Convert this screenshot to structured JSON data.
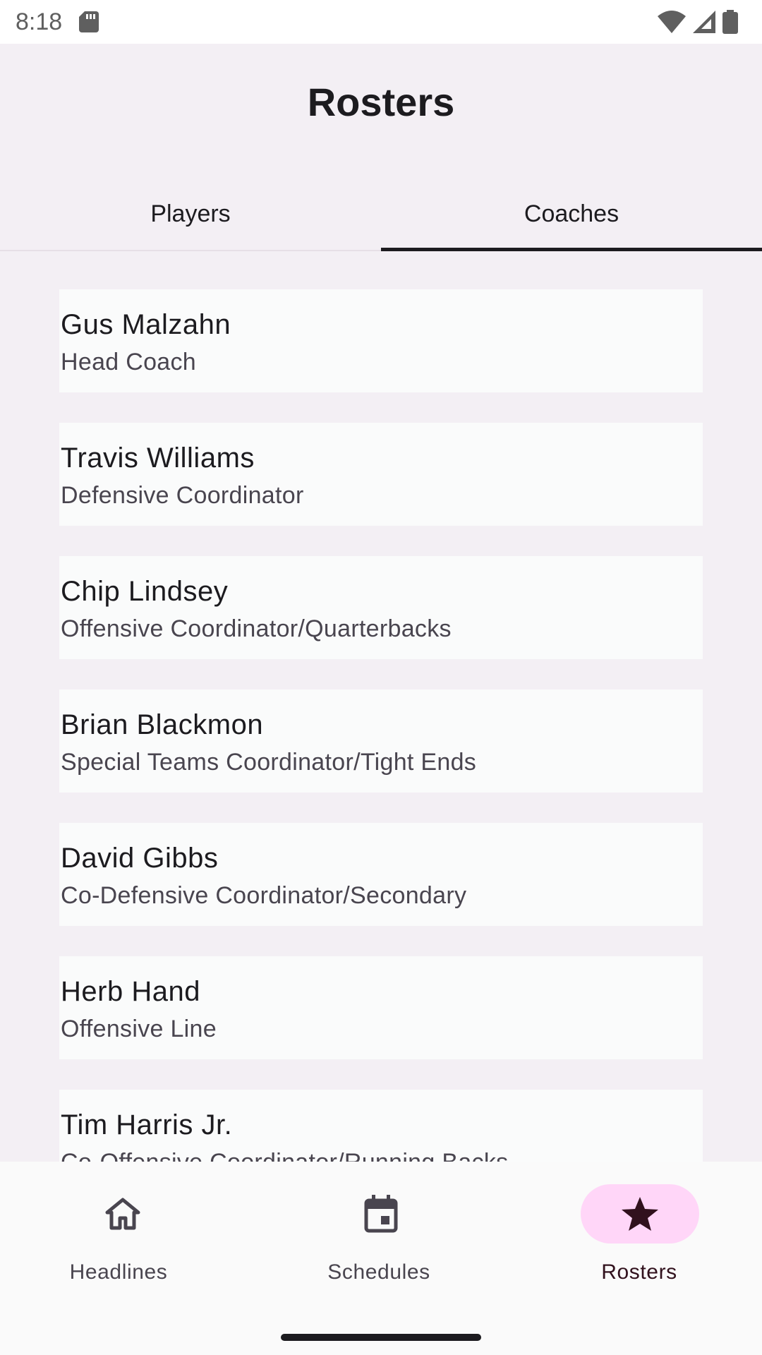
{
  "status_bar": {
    "time": "8:18",
    "icons": [
      "sd-card-icon",
      "wifi-icon",
      "cell-signal-icon",
      "battery-icon"
    ]
  },
  "app": {
    "title": "Rosters"
  },
  "tabs": [
    {
      "label": "Players",
      "selected": false
    },
    {
      "label": "Coaches",
      "selected": true
    }
  ],
  "coaches": [
    {
      "name": "Gus Malzahn",
      "role": "Head Coach"
    },
    {
      "name": "Travis Williams",
      "role": "Defensive Coordinator"
    },
    {
      "name": "Chip Lindsey",
      "role": "Offensive Coordinator/Quarterbacks"
    },
    {
      "name": "Brian Blackmon",
      "role": "Special Teams Coordinator/Tight Ends"
    },
    {
      "name": "David Gibbs",
      "role": "Co-Defensive Coordinator/Secondary"
    },
    {
      "name": "Herb Hand",
      "role": "Offensive Line"
    },
    {
      "name": "Tim Harris Jr.",
      "role": "Co-Offensive Coordinator/Running Backs"
    }
  ],
  "bottom_nav": {
    "items": [
      {
        "label": "Headlines",
        "icon": "home-icon",
        "active": false
      },
      {
        "label": "Schedules",
        "icon": "calendar-icon",
        "active": false
      },
      {
        "label": "Rosters",
        "icon": "star-icon",
        "active": true
      }
    ],
    "active_pill_color": "#ffd6f8"
  }
}
